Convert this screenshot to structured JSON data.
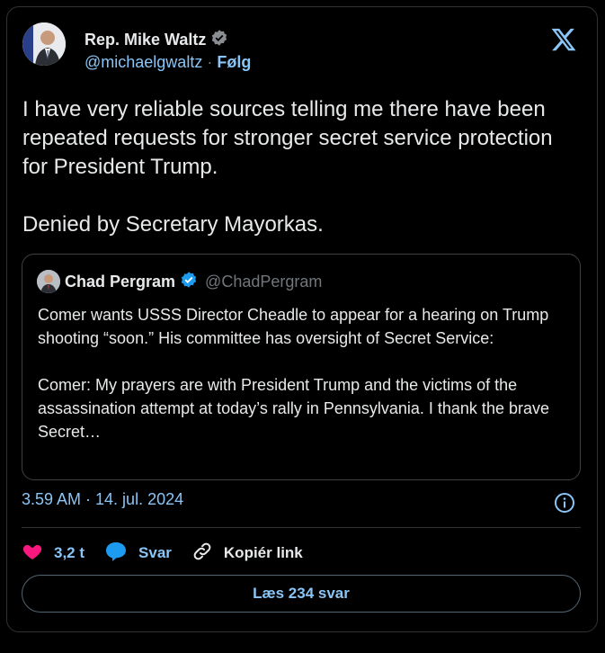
{
  "author": {
    "name": "Rep. Mike Waltz",
    "handle": "@michaelgwaltz",
    "separator": "·",
    "follow_label": "Følg"
  },
  "tweet": {
    "text": "I have very reliable sources telling me there have been repeated requests for stronger secret service protection for President Trump.\n\nDenied by Secretary Mayorkas."
  },
  "quote": {
    "name": "Chad Pergram",
    "handle": "@ChadPergram",
    "text": "Comer wants USSS Director Cheadle to appear for a hearing on Trump shooting “soon.” His committee has oversight of Secret Service:\n\nComer: My prayers are with President Trump and the victims of the assassination attempt at today’s rally in Pennsylvania. I thank the brave Secret…"
  },
  "meta": {
    "timestamp": "3.59 AM · 14. jul. 2024"
  },
  "actions": {
    "like_count": "3,2 t",
    "reply_label": "Svar",
    "copy_link_label": "Kopiér link"
  },
  "read_replies_label": "Læs 234 svar",
  "icons": {
    "verified": "verified-badge-icon",
    "x_logo": "x-logo-icon",
    "info": "info-icon",
    "like": "heart-icon",
    "reply": "reply-bubble-icon",
    "link": "link-icon"
  },
  "colors": {
    "accent": "#8ac5f7",
    "like": "#f91880",
    "reply": "#1d9bf0",
    "verified": "#1d9bf0"
  }
}
